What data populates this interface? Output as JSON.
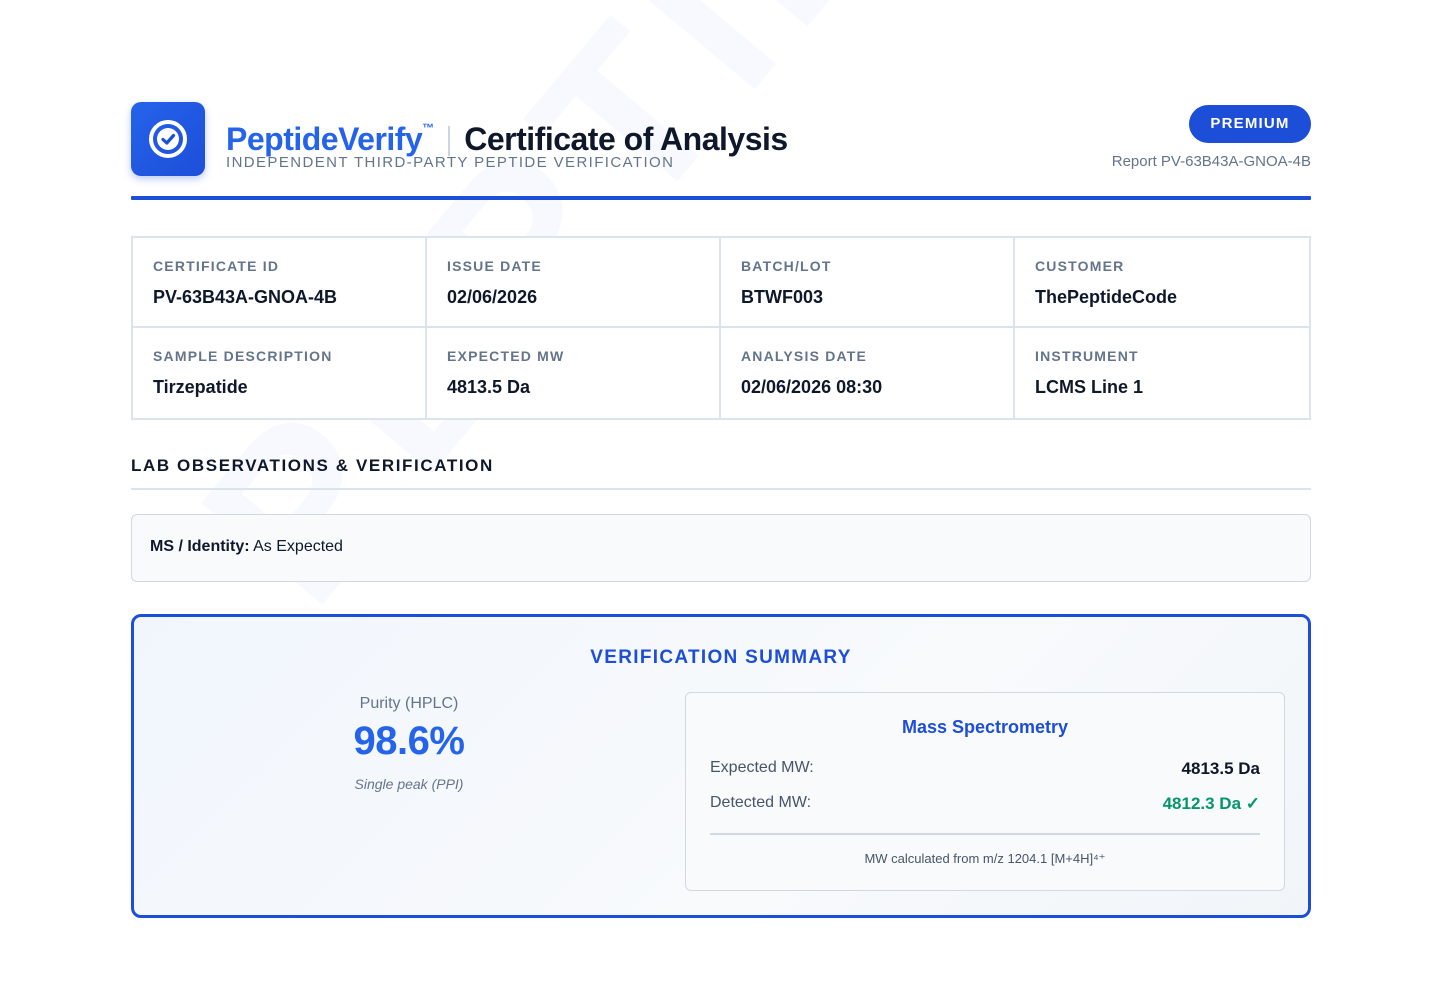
{
  "watermark": "PEPTIDEVERIFY",
  "header": {
    "logo_icon": "verified-check-icon",
    "brand": "PeptideVerify",
    "trademark": "™",
    "title": "Certificate of Analysis",
    "tagline": "INDEPENDENT THIRD-PARTY PEPTIDE VERIFICATION",
    "badge": "PREMIUM",
    "report_id": "Report PV-63B43A-GNOA-4B"
  },
  "info": {
    "certificate_id": {
      "label": "CERTIFICATE ID",
      "value": "PV-63B43A-GNOA-4B"
    },
    "issue_date": {
      "label": "ISSUE DATE",
      "value": "02/06/2026"
    },
    "batch_lot": {
      "label": "BATCH/LOT",
      "value": "BTWF003"
    },
    "customer": {
      "label": "CUSTOMER",
      "value": "ThePeptideCode"
    },
    "sample_description": {
      "label": "SAMPLE DESCRIPTION",
      "value": "Tirzepatide"
    },
    "expected_mw": {
      "label": "EXPECTED MW",
      "value": "4813.5 Da"
    },
    "analysis_date": {
      "label": "ANALYSIS DATE",
      "value": "02/06/2026 08:30"
    },
    "instrument": {
      "label": "INSTRUMENT",
      "value": "LCMS Line 1"
    }
  },
  "observations": {
    "section_title": "LAB OBSERVATIONS & VERIFICATION",
    "ms_identity_label": "MS / Identity:",
    "ms_identity_value": " As Expected"
  },
  "summary": {
    "title": "VERIFICATION SUMMARY",
    "purity_label": "Purity (HPLC)",
    "purity_value": "98.6%",
    "purity_note": "Single peak (PPI)",
    "mass_spec": {
      "title": "Mass Spectrometry",
      "expected_label": "Expected MW:",
      "expected_value": "4813.5 Da",
      "detected_label": "Detected MW:",
      "detected_value": "4812.3 Da ✓",
      "note": "MW calculated from m/z 1204.1 [M+4H]⁴⁺"
    }
  },
  "colors": {
    "brand": "#2563eb",
    "brand_dark": "#1d4ed8",
    "success": "#059669",
    "muted": "#64748b"
  }
}
